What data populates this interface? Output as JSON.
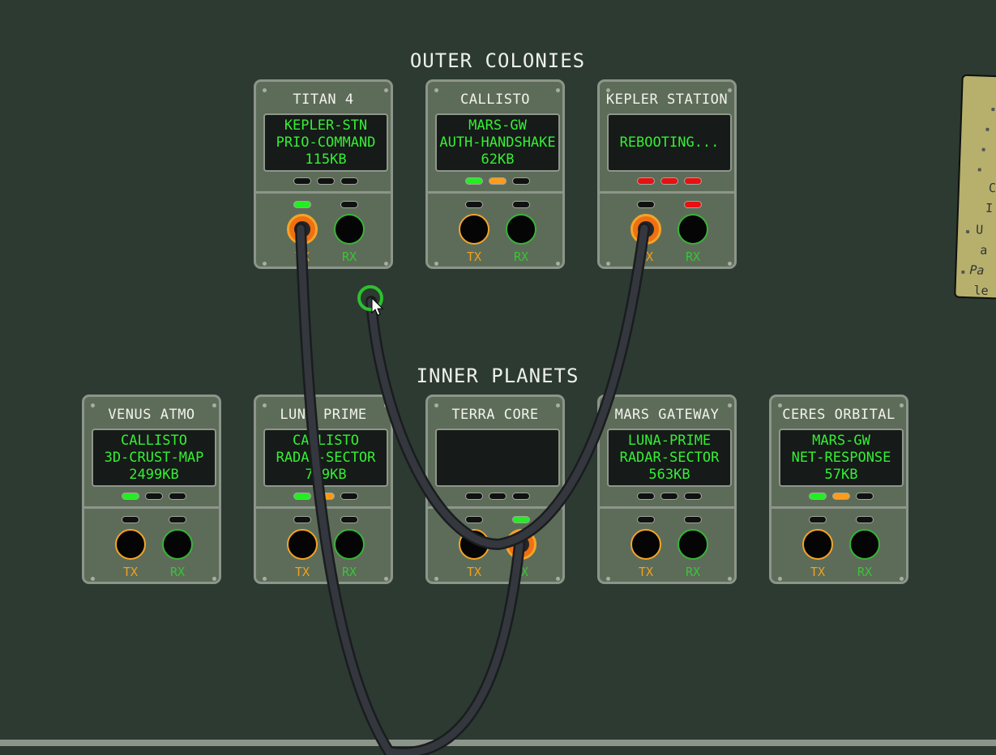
{
  "groups": {
    "outer": "OUTER COLONIES",
    "inner": "INNER PLANETS"
  },
  "modules": {
    "titan4": {
      "name": "TITAN 4",
      "screen": [
        "KEPLER-STN",
        "PRIO-COMMAND",
        "115KB"
      ],
      "tx": "TX",
      "rx": "RX"
    },
    "callisto": {
      "name": "CALLISTO",
      "screen": [
        "MARS-GW",
        "AUTH-HANDSHAKE",
        "62KB"
      ],
      "tx": "TX",
      "rx": "RX"
    },
    "kepler": {
      "name": "KEPLER STATION",
      "screen": [
        "REBOOTING..."
      ],
      "tx": "TX",
      "rx": "RX"
    },
    "venus": {
      "name": "VENUS ATMO",
      "screen": [
        "CALLISTO",
        "3D-CRUST-MAP",
        "2499KB"
      ],
      "tx": "TX",
      "rx": "RX"
    },
    "luna": {
      "name": "LUNA PRIME",
      "screen": [
        "CALLISTO",
        "RADAR-SECTOR",
        "739KB"
      ],
      "tx": "TX",
      "rx": "RX"
    },
    "terra": {
      "name": "TERRA CORE",
      "screen": [],
      "tx": "TX",
      "rx": "RX"
    },
    "mars": {
      "name": "MARS GATEWAY",
      "screen": [
        "LUNA-PRIME",
        "RADAR-SECTOR",
        "563KB"
      ],
      "tx": "TX",
      "rx": "RX"
    },
    "ceres": {
      "name": "CERES ORBITAL",
      "screen": [
        "MARS-GW",
        "NET-RESPONSE",
        "57KB"
      ],
      "tx": "TX",
      "rx": "RX"
    }
  },
  "status_lights": {
    "titan4": [
      "off",
      "off",
      "off"
    ],
    "callisto": [
      "green",
      "orange",
      "off"
    ],
    "kepler": [
      "red",
      "red",
      "red"
    ],
    "venus": [
      "green",
      "off",
      "off"
    ],
    "luna": [
      "green",
      "orange",
      "off"
    ],
    "terra": [
      "off",
      "off",
      "off"
    ],
    "mars": [
      "off",
      "off",
      "off"
    ],
    "ceres": [
      "green",
      "orange",
      "off"
    ]
  },
  "jack_lights": {
    "titan4": [
      "green",
      "off"
    ],
    "callisto": [
      "off",
      "off"
    ],
    "kepler": [
      "off",
      "red"
    ],
    "venus": [
      "off",
      "off"
    ],
    "luna": [
      "off",
      "off"
    ],
    "terra": [
      "off",
      "green"
    ],
    "mars": [
      "off",
      "off"
    ],
    "ceres": [
      "off",
      "off"
    ]
  },
  "plugged_jacks": [
    "titan4.tx",
    "kepler.tx",
    "terra.rx"
  ],
  "note_fragments": [
    "C",
    "I",
    "U",
    "a",
    "Pa",
    "le"
  ],
  "colors": {
    "background": "#2c3a32",
    "panel": "#5d6c58",
    "screen_text": "#34ef34",
    "tx": "#f0a020",
    "rx": "#36c636",
    "cable": "#2c2f34"
  }
}
